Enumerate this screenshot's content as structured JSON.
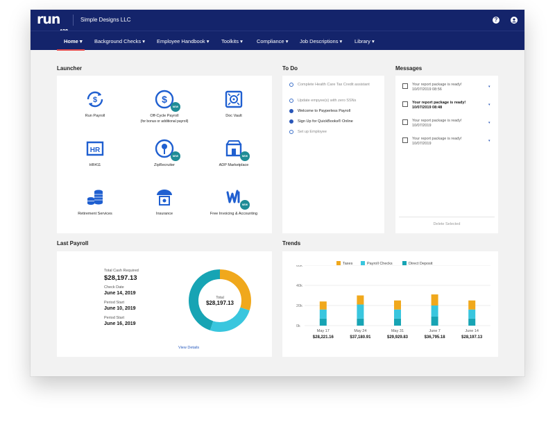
{
  "header": {
    "logo": "run",
    "logo_tagline": "POWERED BY",
    "logo_brand": "ADP",
    "company": "Simple Designs LLC",
    "help_icon": "question-circle-icon",
    "user_icon": "user-circle-icon"
  },
  "nav": {
    "items": [
      {
        "label": "Home"
      },
      {
        "label": "Background Checks"
      },
      {
        "label": "Employee Handbook"
      },
      {
        "label": "Toolkits"
      },
      {
        "label": "Compliance"
      },
      {
        "label": "Job Descriptions"
      },
      {
        "label": "Library"
      }
    ],
    "active": "Home",
    "active_underline_color": "#e34b4b"
  },
  "launcher": {
    "title": "Launcher",
    "items": [
      {
        "label": "Run Payroll",
        "sub": "",
        "icon": "dollar-cycle-icon",
        "new": false
      },
      {
        "label": "Off-Cycle Payroll",
        "sub": "(for bonus or additional payroll)",
        "icon": "dollar-circle-icon",
        "new": true
      },
      {
        "label": "Doc Vault",
        "sub": "",
        "icon": "vault-icon",
        "new": false
      },
      {
        "label": "HR411",
        "sub": "",
        "icon": "hr-badge-icon",
        "new": false
      },
      {
        "label": "ZipRecruiter",
        "sub": "",
        "icon": "ziprecruiter-icon",
        "new": true
      },
      {
        "label": "ADP Marketplace",
        "sub": "",
        "icon": "marketplace-icon",
        "new": true
      },
      {
        "label": "Retirement Services",
        "sub": "",
        "icon": "coins-icon",
        "new": false
      },
      {
        "label": "Insurance",
        "sub": "",
        "icon": "umbrella-icon",
        "new": false
      },
      {
        "label": "Free Invoicing & Accounting",
        "sub": "",
        "icon": "wave-icon",
        "new": true
      }
    ],
    "badge_label": "NEW"
  },
  "todo": {
    "title": "To Do",
    "items": [
      {
        "label": "Complete Health Care Tax Credit assistant",
        "done": false,
        "muted": true
      },
      {
        "label": "Update empyee(s) with zero SSNs",
        "done": false,
        "muted": true
      },
      {
        "label": "Welcome to Payperless Payroll",
        "done": true,
        "muted": false
      },
      {
        "label": "Sign Up for QuickBooks® Online",
        "done": true,
        "muted": false
      },
      {
        "label": "Set up Employee",
        "done": false,
        "muted": true
      }
    ]
  },
  "messages": {
    "title": "Messages",
    "items": [
      {
        "text": "Your report package is ready!",
        "date": "10/07/2019 08:56",
        "unread": false
      },
      {
        "text": "Your report package is ready!",
        "date": "10/07/2019 08:48",
        "unread": true
      },
      {
        "text": "Your report package is ready!",
        "date": "10/07/2019",
        "unread": false
      },
      {
        "text": "Your report package is ready!",
        "date": "10/07/2019",
        "unread": false
      }
    ],
    "delete_label": "Delete Selected"
  },
  "last_payroll": {
    "title": "Last Payroll",
    "total_cash_label": "Total Cash Required",
    "total_cash_value": "$28,197.13",
    "check_date_label": "Check Date",
    "check_date_value": "June 14, 2019",
    "period_start_label": "Period Start",
    "period_start_value": "June 10, 2019",
    "period_end_label": "Period Start",
    "period_end_value": "June 16, 2019",
    "donut_center_label": "Total",
    "donut_center_value": "$28,197.13",
    "view_details": "View Details"
  },
  "trends": {
    "title": "Trends"
  },
  "chart_data": [
    {
      "type": "pie",
      "variant": "donut",
      "slices": [
        {
          "label": "Taxes",
          "value": 30,
          "color": "#f0a81c"
        },
        {
          "label": "Payroll Checks",
          "value": 25,
          "color": "#39c6de"
        },
        {
          "label": "Direct Deposit",
          "value": 45,
          "color": "#17a4b4"
        }
      ]
    },
    {
      "type": "bar",
      "stacked": true,
      "categories": [
        "May 17",
        "May 24",
        "May 31",
        "June 7",
        "June 14"
      ],
      "category_totals": [
        "$28,221.16",
        "$37,180.91",
        "$29,929.83",
        "$36,795.18",
        "$28,197.13"
      ],
      "series": [
        {
          "name": "Direct Deposit",
          "color": "#17a4b4",
          "values": [
            7000,
            7000,
            7000,
            9000,
            7000
          ]
        },
        {
          "name": "Payroll Checks",
          "color": "#39c6de",
          "values": [
            9000,
            14000,
            9000,
            11000,
            9000
          ]
        },
        {
          "name": "Taxes",
          "color": "#f0a81c",
          "values": [
            8000,
            9000,
            9000,
            11000,
            9000
          ]
        }
      ],
      "legend_order": [
        "Taxes",
        "Payroll Checks",
        "Direct Deposit"
      ],
      "ylim": [
        0,
        60000
      ],
      "yticks": [
        "0k",
        "20k",
        "40k",
        "60k"
      ],
      "ytick_values": [
        0,
        20000,
        40000,
        60000
      ],
      "grid": true,
      "legend_position": "top"
    }
  ]
}
